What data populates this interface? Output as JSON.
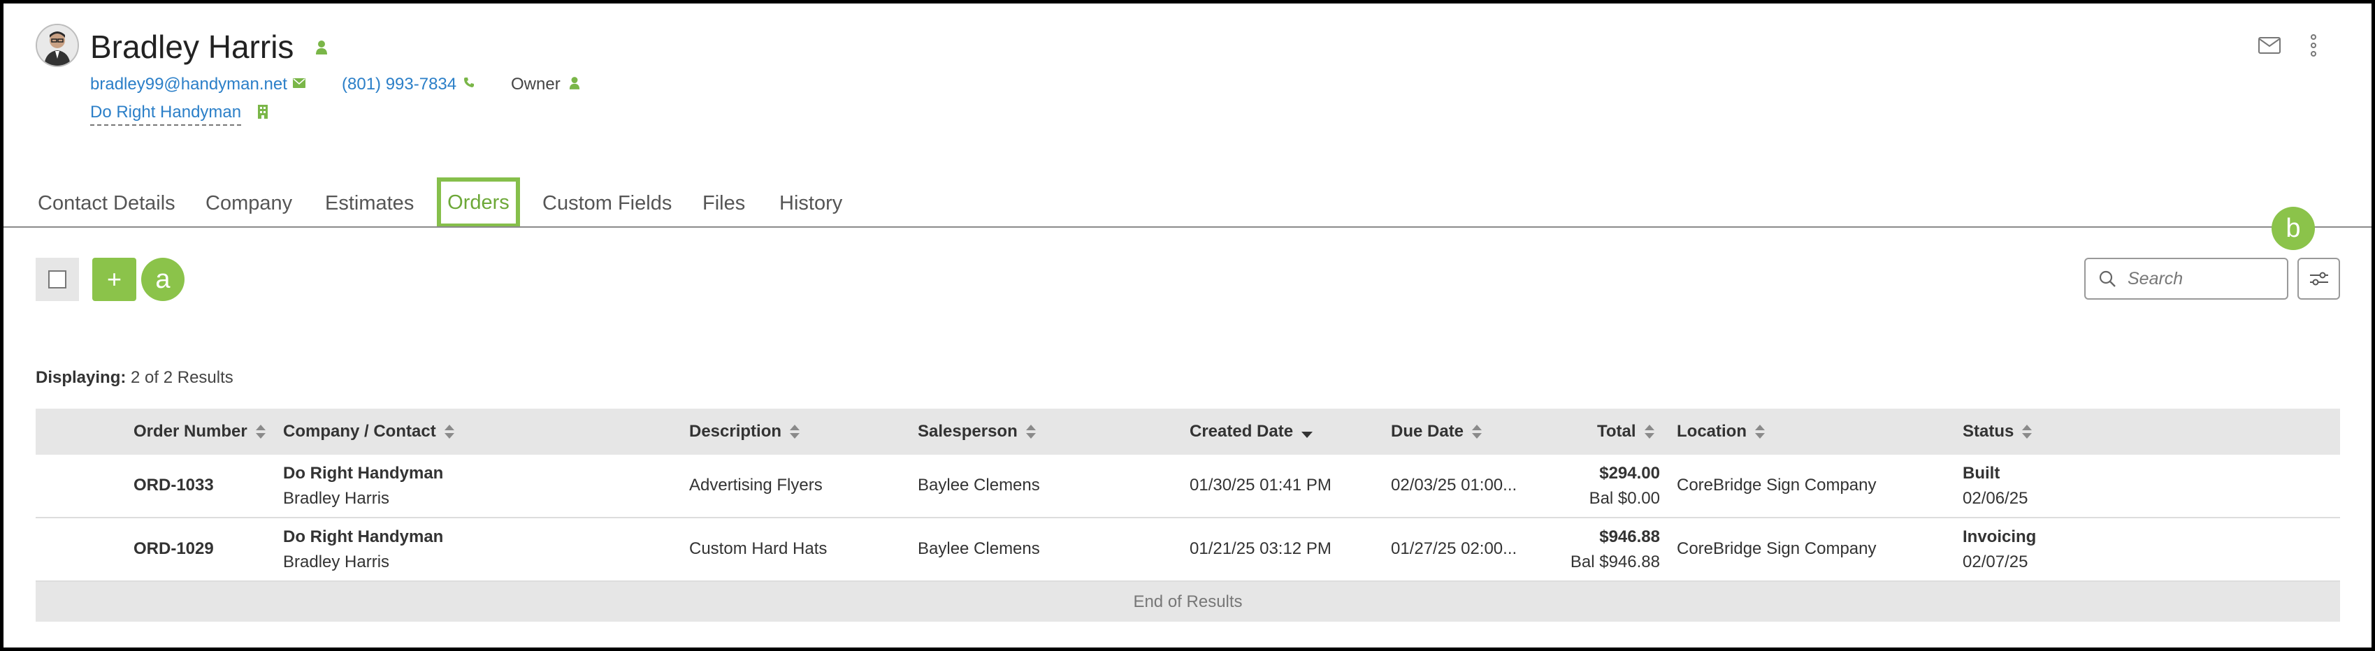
{
  "contact": {
    "name": "Bradley Harris",
    "email": "bradley99@handyman.net",
    "phone": "(801) 993-7834",
    "role": "Owner",
    "company": "Do Right Handyman"
  },
  "tabs": [
    "Contact Details",
    "Company",
    "Estimates",
    "Orders",
    "Custom Fields",
    "Files",
    "History"
  ],
  "active_tab": "Orders",
  "callouts": {
    "a": "a",
    "b": "b"
  },
  "toolbar": {
    "add_label": "+",
    "search_placeholder": "Search"
  },
  "displaying": {
    "label": "Displaying:",
    "value": "2 of 2 Results"
  },
  "table": {
    "columns": [
      "Order Number",
      "Company / Contact",
      "Description",
      "Salesperson",
      "Created Date",
      "Due Date",
      "Total",
      "Location",
      "Status"
    ],
    "rows": [
      {
        "order_number": "ORD-1033",
        "company": "Do Right Handyman",
        "contact": "Bradley Harris",
        "description": "Advertising Flyers",
        "salesperson": "Baylee Clemens",
        "created": "01/30/25 01:41 PM",
        "due": "02/03/25 01:00...",
        "total": "$294.00",
        "balance": "Bal $0.00",
        "location": "CoreBridge Sign Company",
        "status": "Built",
        "status_date": "02/06/25"
      },
      {
        "order_number": "ORD-1029",
        "company": "Do Right Handyman",
        "contact": "Bradley Harris",
        "description": "Custom Hard Hats",
        "salesperson": "Baylee Clemens",
        "created": "01/21/25 03:12 PM",
        "due": "01/27/25 02:00...",
        "total": "$946.88",
        "balance": "Bal $946.88",
        "location": "CoreBridge Sign Company",
        "status": "Invoicing",
        "status_date": "02/07/25"
      }
    ],
    "footer": "End of Results"
  },
  "colors": {
    "accent": "#8bc34a",
    "link": "#2b7fc8",
    "header_bg": "#e6e6e6"
  }
}
